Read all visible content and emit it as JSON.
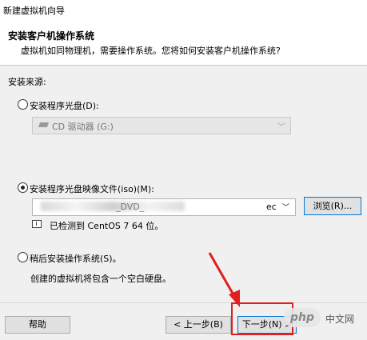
{
  "window": {
    "title": "新建虚拟机向导"
  },
  "header": {
    "title": "安装客户机操作系统",
    "subtitle": "虚拟机如同物理机，需要操作系统。您将如何安装客户机操作系统?"
  },
  "install_source": {
    "label": "安装来源:",
    "option_disc": {
      "label": "安装程序光盘(D):",
      "selected": false
    },
    "drive_select": {
      "value": "CD 驱动器 (G:)",
      "enabled": false
    },
    "option_iso": {
      "label": "安装程序光盘映像文件(iso)(M):",
      "selected": true
    },
    "iso_path": {
      "prefix": "",
      "visible_fragment": "_DVD_",
      "suffix": "ec",
      "blurred": true
    },
    "browse_label": "浏览(R)...",
    "detected_text": "已检测到 CentOS 7 64 位。",
    "option_later": {
      "label": "稍后安装操作系统(S)。",
      "selected": false
    },
    "later_desc": "创建的虚拟机将包含一个空白硬盘。"
  },
  "footer": {
    "help_label": "帮助",
    "back_label": "< 上一步(B)",
    "next_label": "下一步(N) >"
  },
  "overlay": {
    "highlight_color": "#e02020",
    "watermark_badge": "php",
    "watermark_text": "中文网"
  }
}
